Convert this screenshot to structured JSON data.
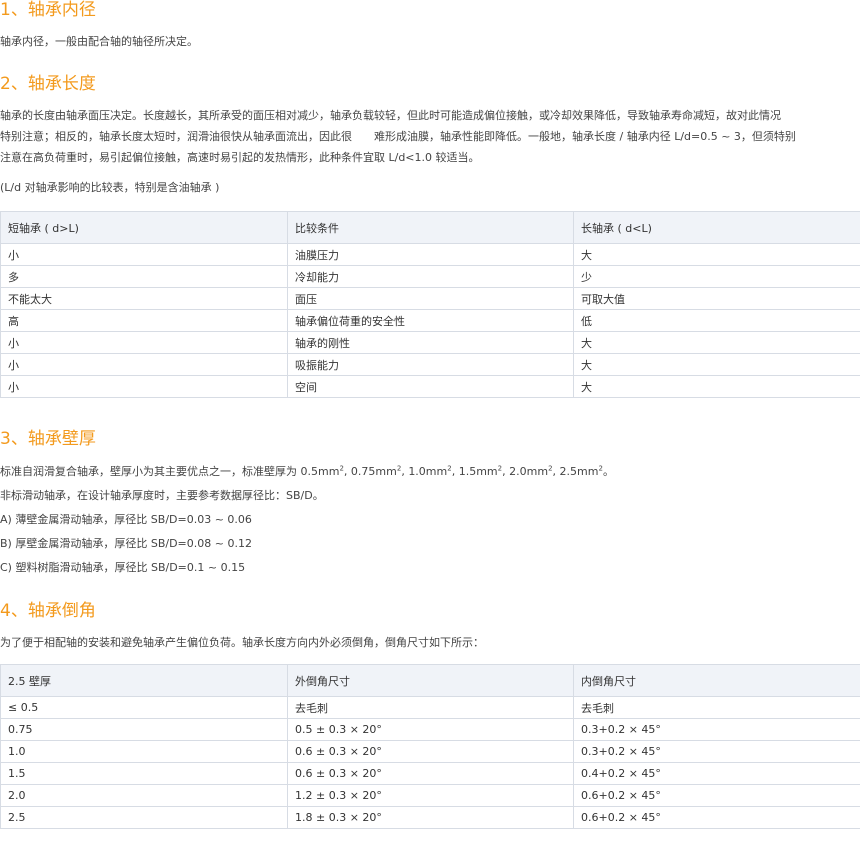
{
  "section1": {
    "title": "1、轴承内径",
    "text": "轴承内径，一般由配合轴的轴径所决定。"
  },
  "section2": {
    "title": "2、轴承长度",
    "lines": [
      "轴承的长度由轴承面压决定。长度越长，其所承受的面压相对减少，轴承负载较轻，但此时可能造成偏位接触，或冷却效果降低，导致轴承寿命减短，故对此情况",
      "特别注意；相反的，轴承长度太短时，润滑油很快从轴承面流出，因此很　　难形成油膜，轴承性能即降低。一般地，轴承长度 / 轴承内径 L/d=0.5 ~ 3，但须特别",
      "注意在高负荷重时，易引起偏位接触，高速时易引起的发热情形，此种条件宜取 L/d<1.0 较适当。"
    ],
    "caption": "(L/d 对轴承影响的比较表，特别是含油轴承 )",
    "table": {
      "headers": [
        "短轴承 ( d>L)",
        "比较条件",
        "长轴承 ( d<L)"
      ],
      "rows": [
        [
          "小",
          "油膜压力",
          "大"
        ],
        [
          "多",
          "冷却能力",
          "少"
        ],
        [
          "不能太大",
          "面压",
          "可取大值"
        ],
        [
          "高",
          "轴承偏位荷重的安全性",
          "低"
        ],
        [
          "小",
          "轴承的刚性",
          "大"
        ],
        [
          "小",
          "吸振能力",
          "大"
        ],
        [
          "小",
          "空间",
          "大"
        ]
      ]
    }
  },
  "section3": {
    "title": "3、轴承壁厚",
    "line1_prefix": "标准自润滑复合轴承，壁厚小为其主要优点之一，标准壁厚为 ",
    "thicknesses": [
      "0.5mm",
      "0.75mm",
      "1.0mm",
      "1.5mm",
      "2.0mm",
      "2.5mm"
    ],
    "superscript": "2",
    "line1_suffix": "。",
    "lines": [
      "非标滑动轴承，在设计轴承厚度时，主要参考数据厚径比：SB/D。",
      "A) 薄壁金属滑动轴承，厚径比 SB/D=0.03 ~ 0.06",
      "B) 厚壁金属滑动轴承，厚径比 SB/D=0.08 ~ 0.12",
      "C) 塑料树脂滑动轴承，厚径比 SB/D=0.1 ~ 0.15"
    ]
  },
  "section4": {
    "title": "4、轴承倒角",
    "text": "为了便于相配轴的安装和避免轴承产生偏位负荷。轴承长度方向内外必须倒角，倒角尺寸如下所示：",
    "table": {
      "headers": [
        "2.5 壁厚",
        "外倒角尺寸",
        "内倒角尺寸"
      ],
      "rows": [
        [
          "≤ 0.5",
          "去毛刺",
          "去毛刺"
        ],
        [
          "0.75",
          "0.5 ± 0.3 × 20°",
          "0.3+0.2 × 45°"
        ],
        [
          "1.0",
          "0.6 ± 0.3 × 20°",
          "0.3+0.2 × 45°"
        ],
        [
          "1.5",
          "0.6 ± 0.3 × 20°",
          "0.4+0.2 × 45°"
        ],
        [
          "2.0",
          "1.2 ± 0.3 × 20°",
          "0.6+0.2 × 45°"
        ],
        [
          "2.5",
          "1.8 ± 0.3 × 20°",
          "0.6+0.2 × 45°"
        ]
      ]
    }
  }
}
